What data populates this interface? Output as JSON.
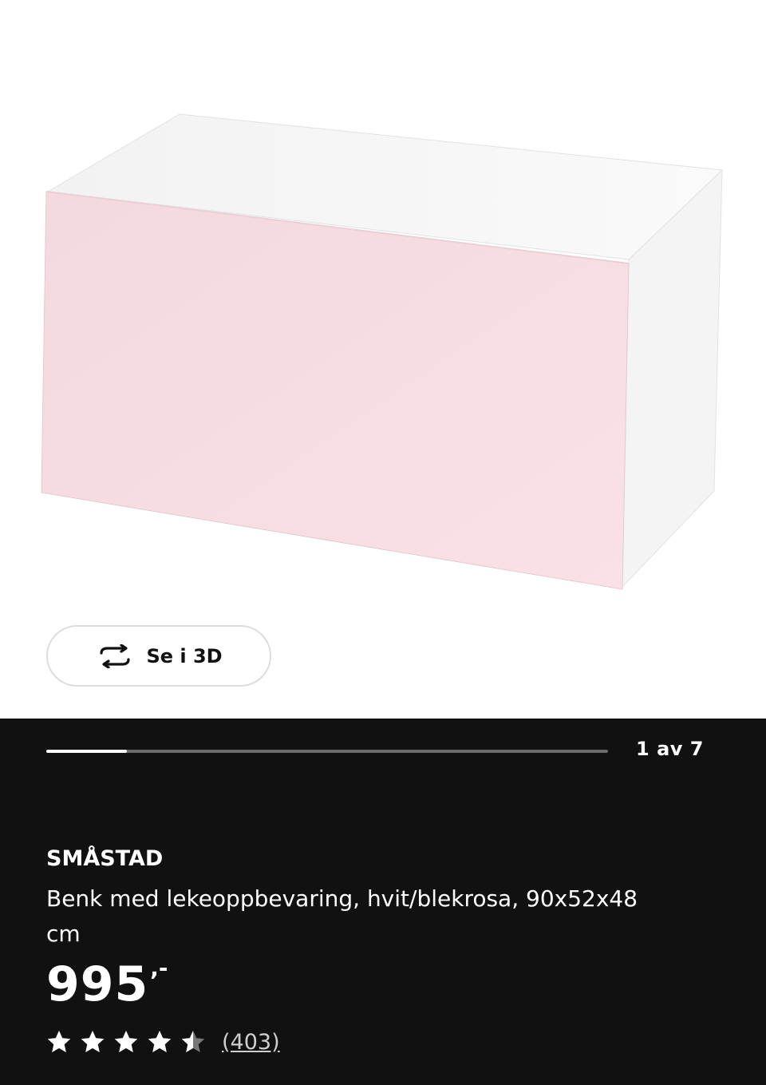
{
  "view_3d": {
    "label": "Se i 3D",
    "icon": "rotate-3d-icon"
  },
  "gallery": {
    "counter": "1 av 7",
    "progress_fraction": 0.143
  },
  "product": {
    "name": "SMÅSTAD",
    "description": "Benk med lekeoppbevaring, hvit/blekrosa, 90x52x48 cm",
    "price": "995",
    "price_suffix": ",-",
    "rating": 4.5,
    "reviews": "(403)"
  },
  "colors": {
    "info_bg": "#111111",
    "front": "#f6dde2",
    "body": "#ffffff"
  }
}
